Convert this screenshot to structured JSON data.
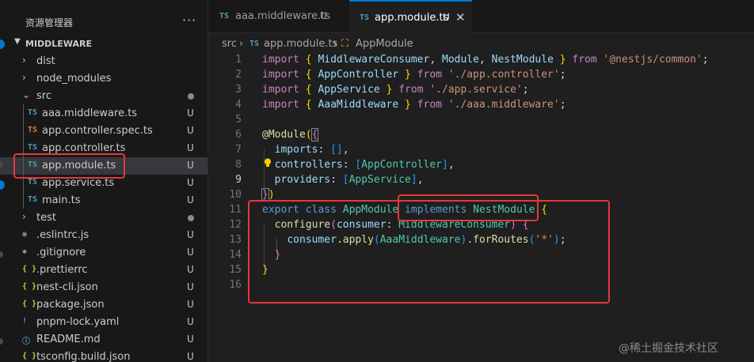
{
  "sidebar": {
    "title": "资源管理器",
    "more": "···",
    "section": "MIDDLEWARE",
    "items": [
      {
        "name": "dist",
        "kind": "folder",
        "chev": "›",
        "indent": 0
      },
      {
        "name": "node_modules",
        "kind": "folder",
        "chev": "›",
        "indent": 0
      },
      {
        "name": "src",
        "kind": "folder",
        "chev": "⌄",
        "indent": 0,
        "status": "dot"
      },
      {
        "name": "aaa.middleware.ts",
        "kind": "ts",
        "indent": 1,
        "status": "U"
      },
      {
        "name": "app.controller.spec.ts",
        "kind": "ts-test",
        "indent": 1,
        "status": "U"
      },
      {
        "name": "app.controller.ts",
        "kind": "ts",
        "indent": 1,
        "status": "U"
      },
      {
        "name": "app.module.ts",
        "kind": "ts",
        "indent": 1,
        "status": "U",
        "selected": true
      },
      {
        "name": "app.service.ts",
        "kind": "ts",
        "indent": 1,
        "status": "U"
      },
      {
        "name": "main.ts",
        "kind": "ts",
        "indent": 1,
        "status": "U"
      },
      {
        "name": "test",
        "kind": "folder",
        "chev": "›",
        "indent": 0,
        "status": "dot"
      },
      {
        "name": ".eslintrc.js",
        "kind": "eslint",
        "indent": 0,
        "status": "U"
      },
      {
        "name": ".gitignore",
        "kind": "git",
        "indent": 0,
        "status": "U"
      },
      {
        "name": ".prettierrc",
        "kind": "json",
        "indent": 0,
        "status": "U"
      },
      {
        "name": "nest-cli.json",
        "kind": "json",
        "indent": 0,
        "status": "U"
      },
      {
        "name": "package.json",
        "kind": "json",
        "indent": 0,
        "status": "U"
      },
      {
        "name": "pnpm-lock.yaml",
        "kind": "yaml",
        "indent": 0,
        "status": "U"
      },
      {
        "name": "README.md",
        "kind": "md",
        "indent": 0,
        "status": "U"
      },
      {
        "name": "tsconfig.build.json",
        "kind": "json",
        "indent": 0,
        "status": "U"
      }
    ]
  },
  "icons": {
    "ts": "TS",
    "ts_test": "TS",
    "json": "{ }",
    "yaml": "!",
    "md": "ⓘ",
    "eslint": "◉",
    "git": "◆"
  },
  "tabs": [
    {
      "label": "aaa.middleware.ts",
      "status": "U",
      "icon": "TS",
      "active": false
    },
    {
      "label": "app.module.ts",
      "status": "U",
      "icon": "TS",
      "active": true,
      "close": "✕"
    }
  ],
  "breadcrumb": {
    "folder": "src",
    "sep": "›",
    "file_icon": "TS",
    "file": "app.module.ts",
    "symbol_icon": "⛶",
    "symbol": "AppModule"
  },
  "editor": {
    "current_line": 9,
    "line_numbers": [
      "1",
      "2",
      "3",
      "4",
      "5",
      "6",
      "7",
      "8",
      "9",
      "10",
      "11",
      "12",
      "13",
      "14",
      "15",
      "16"
    ]
  },
  "watermark": "@稀土掘金技术社区",
  "colors": {
    "accent": "#0078d4",
    "annotation": "#e5383b",
    "ts_icon": "#519aba",
    "ts_test_icon": "#e37933"
  }
}
